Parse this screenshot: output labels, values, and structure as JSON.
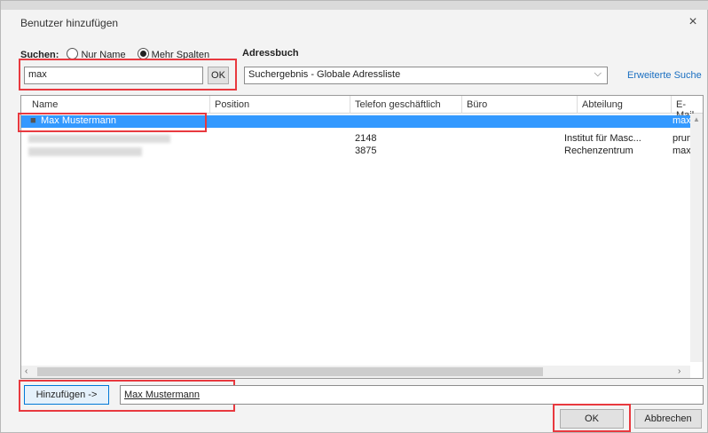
{
  "dialog": {
    "title": "Benutzer hinzufügen",
    "close_glyph": "×"
  },
  "search": {
    "label": "Suchen:",
    "options": [
      "Nur Name",
      "Mehr Spalten"
    ],
    "selected": "Mehr Spalten",
    "value": "max",
    "ok_label": "OK"
  },
  "addressbook": {
    "label": "Adressbuch",
    "selected": "Suchergebnis - Globale Adressliste",
    "advanced_link": "Erweiterte Suche"
  },
  "table": {
    "columns": [
      "Name",
      "Position",
      "Telefon geschäftlich",
      "Büro",
      "Abteilung",
      "E-Mail"
    ],
    "rows": [
      {
        "name": "Max Mustermann",
        "position": "",
        "phone": "",
        "office": "",
        "department": "",
        "email": "max",
        "selected": true
      },
      {
        "name": "",
        "position": "",
        "phone": "2148",
        "office": "",
        "department": "Institut für Masc...",
        "email": "prun",
        "selected": false
      },
      {
        "name": "",
        "position": "",
        "phone": "3875",
        "office": "",
        "department": "Rechenzentrum",
        "email": "maxi",
        "selected": false
      }
    ]
  },
  "add": {
    "button_label": "Hinzufügen ->",
    "value": "Max Mustermann"
  },
  "footer": {
    "ok_label": "OK",
    "cancel_label": "Abbrechen"
  },
  "colors": {
    "highlight": "#e8393f",
    "selection": "#3399ff",
    "link": "#1a6fc1"
  }
}
